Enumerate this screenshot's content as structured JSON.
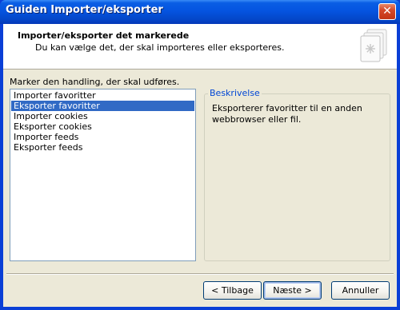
{
  "window": {
    "title": "Guiden Importer/eksporter"
  },
  "header": {
    "title": "Importer/eksporter det markerede",
    "subtitle": "Du kan vælge det, der skal importeres eller eksporteres."
  },
  "instruction": "Marker den handling, der skal udføres.",
  "actions": [
    {
      "label": "Importer favoritter",
      "selected": false
    },
    {
      "label": "Eksporter favoritter",
      "selected": true
    },
    {
      "label": "Importer cookies",
      "selected": false
    },
    {
      "label": "Eksporter cookies",
      "selected": false
    },
    {
      "label": "Importer feeds",
      "selected": false
    },
    {
      "label": "Eksporter feeds",
      "selected": false
    }
  ],
  "description": {
    "legend": "Beskrivelse",
    "text": "Eksporterer favoritter til en anden webbrowser eller fil."
  },
  "buttons": {
    "back": "< Tilbage",
    "next": "Næste >",
    "cancel": "Annuller"
  },
  "colors": {
    "selection": "#316ac5",
    "titlebar": "#0554e0",
    "legend": "#0046d5"
  }
}
